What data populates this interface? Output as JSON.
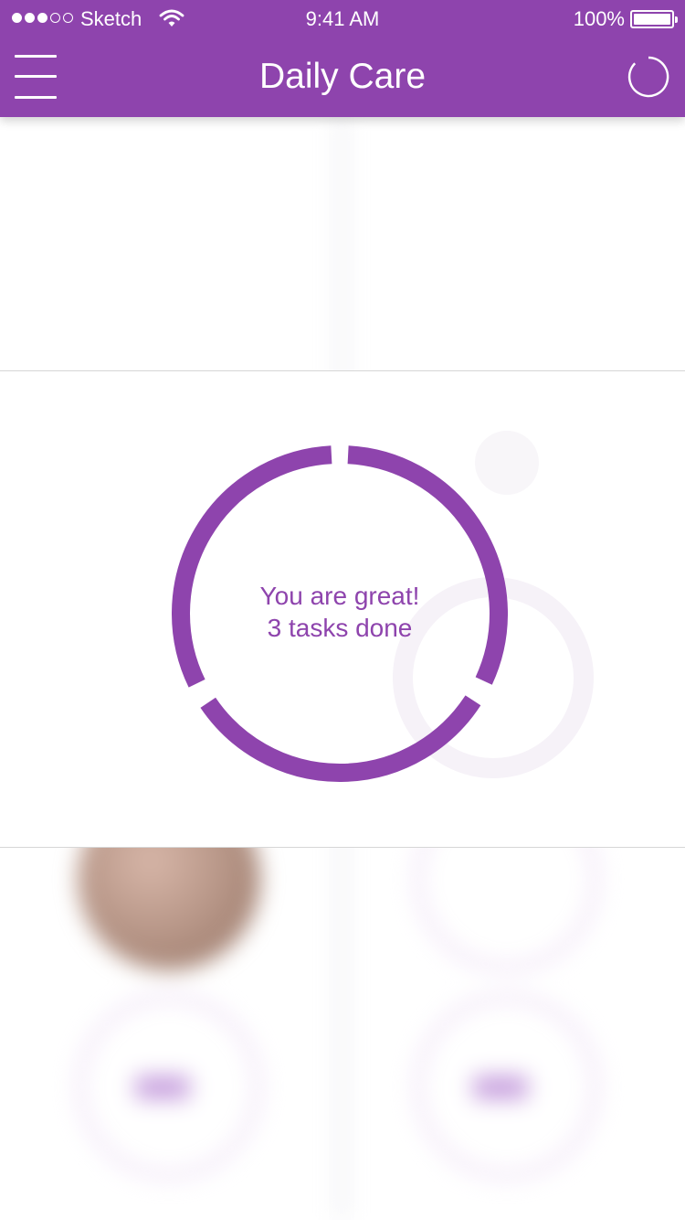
{
  "status_bar": {
    "carrier": "Sketch",
    "time": "9:41 AM",
    "battery": "100%",
    "signal_bars_filled": 3,
    "signal_bars_total": 5
  },
  "nav": {
    "title": "Daily Care",
    "left_icon": "menu-icon",
    "right_icon": "sync-circle-icon"
  },
  "progress_card": {
    "message": "You are great!",
    "tasks_done": "3 tasks done",
    "ring_color": "#8e44ad"
  },
  "colors": {
    "accent": "#8e44ad",
    "background": "#ffffff"
  }
}
